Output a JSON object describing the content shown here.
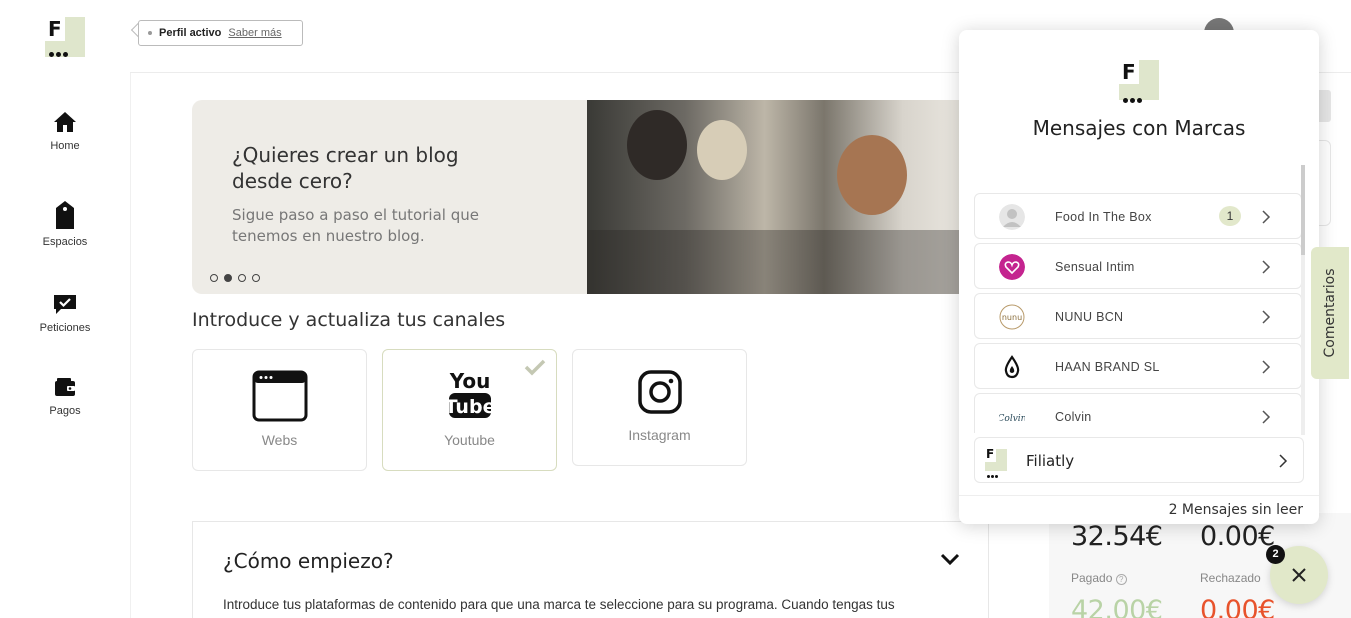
{
  "sidebar": {
    "logo_letter": "F",
    "items": [
      {
        "label": "Home",
        "icon": "home-icon"
      },
      {
        "label": "Espacios",
        "icon": "tag-icon"
      },
      {
        "label": "Peticiones",
        "icon": "chat-check-icon"
      },
      {
        "label": "Pagos",
        "icon": "wallet-icon"
      }
    ]
  },
  "topbar": {
    "profile_status": "Perfil activo",
    "learn_more": "Saber más"
  },
  "banner": {
    "title": "¿Quieres crear un blog desde cero?",
    "subtitle": "Sigue paso a paso el tutorial que tenemos en nuestro blog.",
    "active_dot": 1,
    "dot_count": 4
  },
  "channels": {
    "title": "Introduce y actualiza tus canales",
    "items": [
      {
        "label": "Webs",
        "selected": false
      },
      {
        "label": "Youtube",
        "selected": true
      },
      {
        "label": "Instagram",
        "selected": false
      }
    ]
  },
  "faq": {
    "title": "¿Cómo empiezo?",
    "text": "Introduce tus plataformas de contenido para que una marca te seleccione para su programa. Cuando tengas tus"
  },
  "stats": {
    "value_1": "32.54€",
    "value_2": "0.00€",
    "paid_label": "Pagado",
    "rejected_label": "Rechazado",
    "paid_value": "42.00€",
    "rejected_value": "0.00€",
    "paid_color": "#b9d3a6",
    "rejected_color": "#e8532c"
  },
  "comments_tab": "Comentarios",
  "chat": {
    "title": "Mensajes con Marcas",
    "brands": [
      {
        "name": "Food In The Box",
        "unread": "1",
        "avatar": "user-icon"
      },
      {
        "name": "Sensual Intim",
        "unread": "",
        "avatar": "heart-icon"
      },
      {
        "name": "NUNU BCN",
        "unread": "",
        "avatar": "nunu-logo"
      },
      {
        "name": "HAAN BRAND SL",
        "unread": "",
        "avatar": "drop-icon"
      },
      {
        "name": "Colvin",
        "unread": "",
        "avatar": "colvin-logo"
      }
    ],
    "filiatly": "Filiatly",
    "unread_text": "2 Mensajes sin leer"
  },
  "fab": {
    "badge": "2"
  },
  "colors": {
    "accent": "#e1e8c9",
    "brand_dark": "#111111"
  }
}
